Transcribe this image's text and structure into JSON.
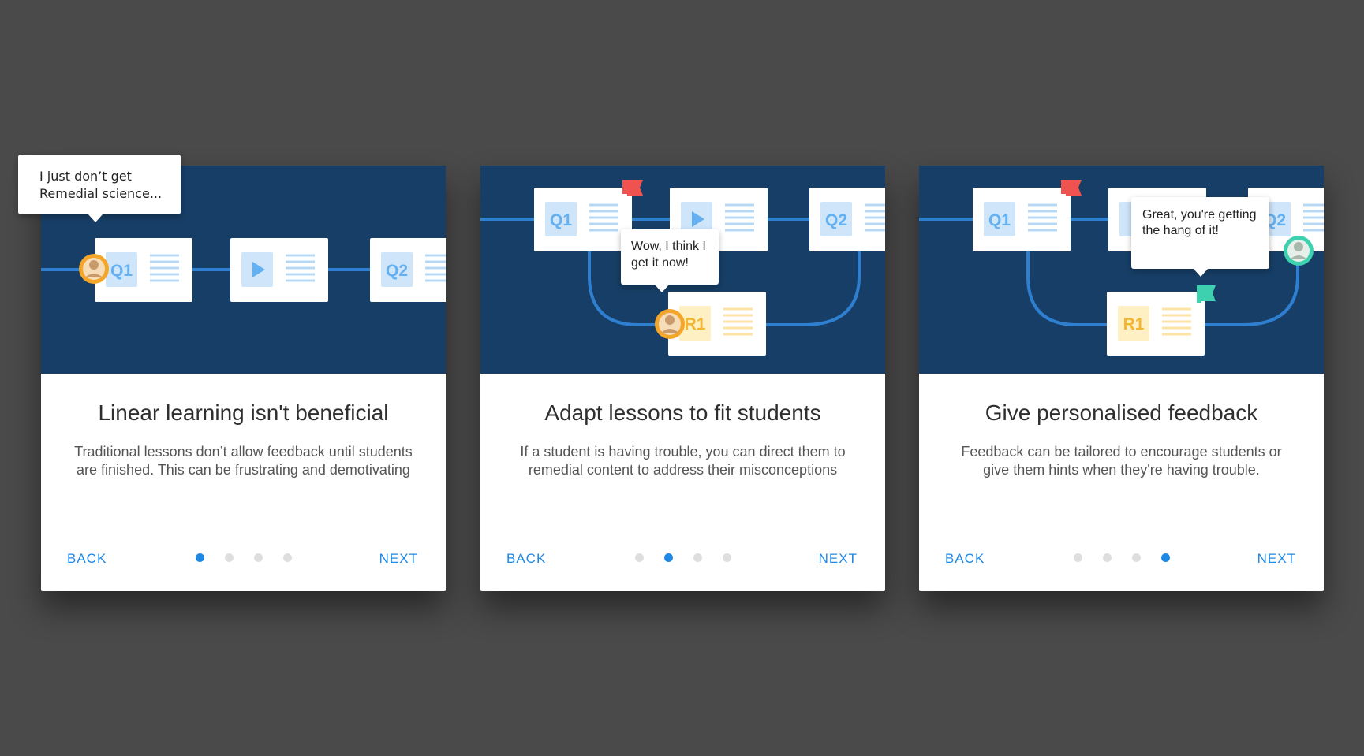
{
  "cards": [
    {
      "title": "Linear learning isn't beneficial",
      "description": "Traditional lessons don’t allow feedback until students are finished. This can be frustrating and demotivating",
      "back_label": "BACK",
      "next_label": "NEXT",
      "speech": "I just don’t get Remedial science...",
      "active_step": 1,
      "step_count": 4,
      "nodes": {
        "q1": "Q1",
        "q2": "Q2"
      }
    },
    {
      "title": "Adapt lessons to fit students",
      "description": "If a student is having trouble, you can direct them to remedial content to address their misconceptions",
      "back_label": "BACK",
      "next_label": "NEXT",
      "speech": "Wow, I think I get it now!",
      "active_step": 2,
      "step_count": 4,
      "nodes": {
        "q1": "Q1",
        "q2": "Q2",
        "r1": "R1"
      }
    },
    {
      "title": "Give personalised feedback",
      "description": "Feedback can be tailored to encourage students or give them hints when they're having trouble.",
      "back_label": "BACK",
      "next_label": "NEXT",
      "speech": "Great, you're getting the hang of it!",
      "active_step": 4,
      "step_count": 4,
      "nodes": {
        "q1": "Q1",
        "q2": "Q2",
        "r1": "R1"
      }
    }
  ],
  "colors": {
    "background": "#4a4a4a",
    "illustration": "#173e66",
    "accent": "#1e88e5",
    "track": "#2f7fd0",
    "quiz_tile": "#cfe5f9",
    "quiz_text": "#64b0f0",
    "remedial_tile": "#fff0c4",
    "remedial_text": "#f3b534",
    "flag_red": "#f0524f",
    "flag_teal": "#3ed1b0",
    "avatar_orange": "#f4a62a"
  }
}
